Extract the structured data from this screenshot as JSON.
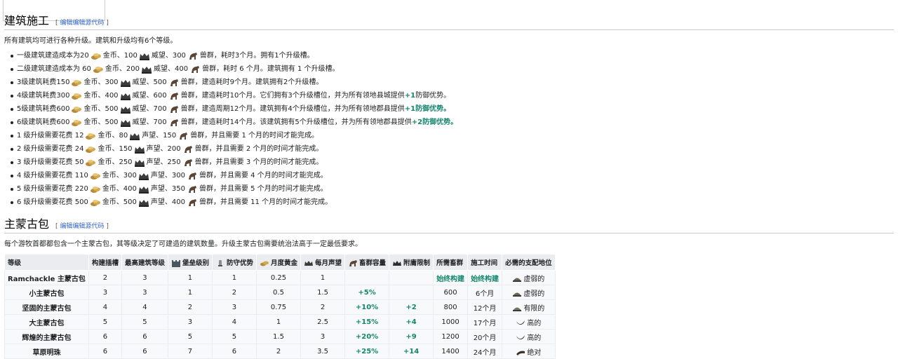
{
  "section1": {
    "title": "建筑施工",
    "edit_bracket_open": "[",
    "edit_link": "编辑",
    "edit_source_link": "编辑源代码",
    "edit_bracket_close": "]",
    "lead": "所有建筑均可进行各种升级。建筑和升级均有6个等级。",
    "items": [
      {
        "pre": "一级建筑建造成本为20",
        "gold": "金币、100",
        "pres": "威望、300",
        "herd": "兽群，耗时3个月。拥有1个升级槽。",
        "tail": "",
        "tail_bonus": ""
      },
      {
        "pre": "二级建筑建造成本为 60",
        "gold": "金币、200",
        "pres": "威望、400",
        "herd": "兽群，耗时 6 个月。建筑拥有 1 个升级槽。",
        "tail": "",
        "tail_bonus": ""
      },
      {
        "pre": "3级建筑耗费150",
        "gold": "金币、300",
        "pres": "威望、500",
        "herd": "兽群，建造耗时9个月。建筑拥有2个升级槽。",
        "tail": "",
        "tail_bonus": ""
      },
      {
        "pre": "4级建筑耗费300",
        "gold": "金币、400",
        "pres": "威望、600",
        "herd": "兽群，建造耗时10个月。它们拥有3个升级槽位，并为所有领地县城提供",
        "tail_bonus": "+1",
        "tail": "防御优势。"
      },
      {
        "pre": "5级建筑耗费600",
        "gold": "金币、500",
        "pres": "威望、700",
        "herd": "兽群，建造周期12个月。建筑拥有4个升级槽位，并为所有领地郡县提供",
        "tail_bonus": "+1防御优势。",
        "tail": ""
      },
      {
        "pre": "6级建筑耗费600",
        "gold": "金币、500",
        "pres": "威望、700",
        "herd": "兽群，建造耗时14个月。该建筑拥有5个升级槽位，并为所有领地郡县提供",
        "tail_bonus": "+2防御优势。",
        "tail": ""
      },
      {
        "pre": "1 级升级需要花费 12",
        "gold": "金币、80",
        "pres": "声望、150",
        "herd": "兽群，并且需要 1 个月的时间才能完成。",
        "tail": "",
        "tail_bonus": ""
      },
      {
        "pre": "2 级升级需要花费 24",
        "gold": "金币、150",
        "pres": "声望、200",
        "herd": "兽群，并且需要 2 个月的时间才能完成。",
        "tail": "",
        "tail_bonus": ""
      },
      {
        "pre": "3 级升级需要花费 50",
        "gold": "金币、250",
        "pres": "声望、250",
        "herd": "兽群，并且需要 3 个月的时间才能完成。",
        "tail": "",
        "tail_bonus": ""
      },
      {
        "pre": "4 级升级需要花费 110",
        "gold": "金币、300",
        "pres": "声望、300",
        "herd": "兽群，并且需要 4 个月的时间才能完成。",
        "tail": "",
        "tail_bonus": ""
      },
      {
        "pre": "5 级升级需要花费 220",
        "gold": "金币、400",
        "pres": "声望、350",
        "herd": "兽群，并且需要 5 个月的时间才能完成。",
        "tail": "",
        "tail_bonus": ""
      },
      {
        "pre": "6 级升级需要花费 500",
        "gold": "金币、500",
        "pres": "声望、400",
        "herd": "兽群，并且需要 11 个月的时间才能完成。",
        "tail": "",
        "tail_bonus": ""
      }
    ]
  },
  "section2": {
    "title": "主蒙古包",
    "edit_bracket_open": "[",
    "edit_link": "编辑",
    "edit_source_link": "编辑源代码",
    "edit_bracket_close": "]",
    "lead": "每个游牧首都都包含一个主蒙古包，其等级决定了可建造的建筑数量。升级主蒙古包需要统治法高于一定最低要求。",
    "headers": [
      "等级",
      "构建插槽",
      "最高建筑等级",
      "堡垒级别",
      "防守优势",
      "月度黄金",
      "每月声望",
      "畜群容量",
      "附庸限制",
      "所需畜群",
      "施工时间",
      "必需的支配地位"
    ],
    "rows": [
      [
        "Ramchackle 主蒙古包",
        "2",
        "3",
        "1",
        "1",
        "0.25",
        "1",
        "",
        "",
        "始终构建",
        "始终构建",
        "虚弱的"
      ],
      [
        "小主蒙古包",
        "3",
        "3",
        "1",
        "2",
        "0.5",
        "1.5",
        "+5%",
        "",
        "600",
        "6个月",
        "虚弱的"
      ],
      [
        "坚固的主蒙古包",
        "4",
        "4",
        "2",
        "3",
        "0.75",
        "2",
        "+10%",
        "+2",
        "800",
        "12个月",
        "有限的"
      ],
      [
        "大主蒙古包",
        "5",
        "5",
        "3",
        "4",
        "1",
        "2.5",
        "+15%",
        "+4",
        "1000",
        "17个月",
        "高的"
      ],
      [
        "辉煌的主蒙古包",
        "6",
        "6",
        "5",
        "5",
        "1.5",
        "3",
        "+20%",
        "+9",
        "1200",
        "20个月",
        "高的"
      ],
      [
        "草原明珠",
        "6",
        "6",
        "7",
        "6",
        "2",
        "3.5",
        "+25%",
        "+14",
        "1400",
        "24个月",
        "绝对"
      ]
    ]
  }
}
